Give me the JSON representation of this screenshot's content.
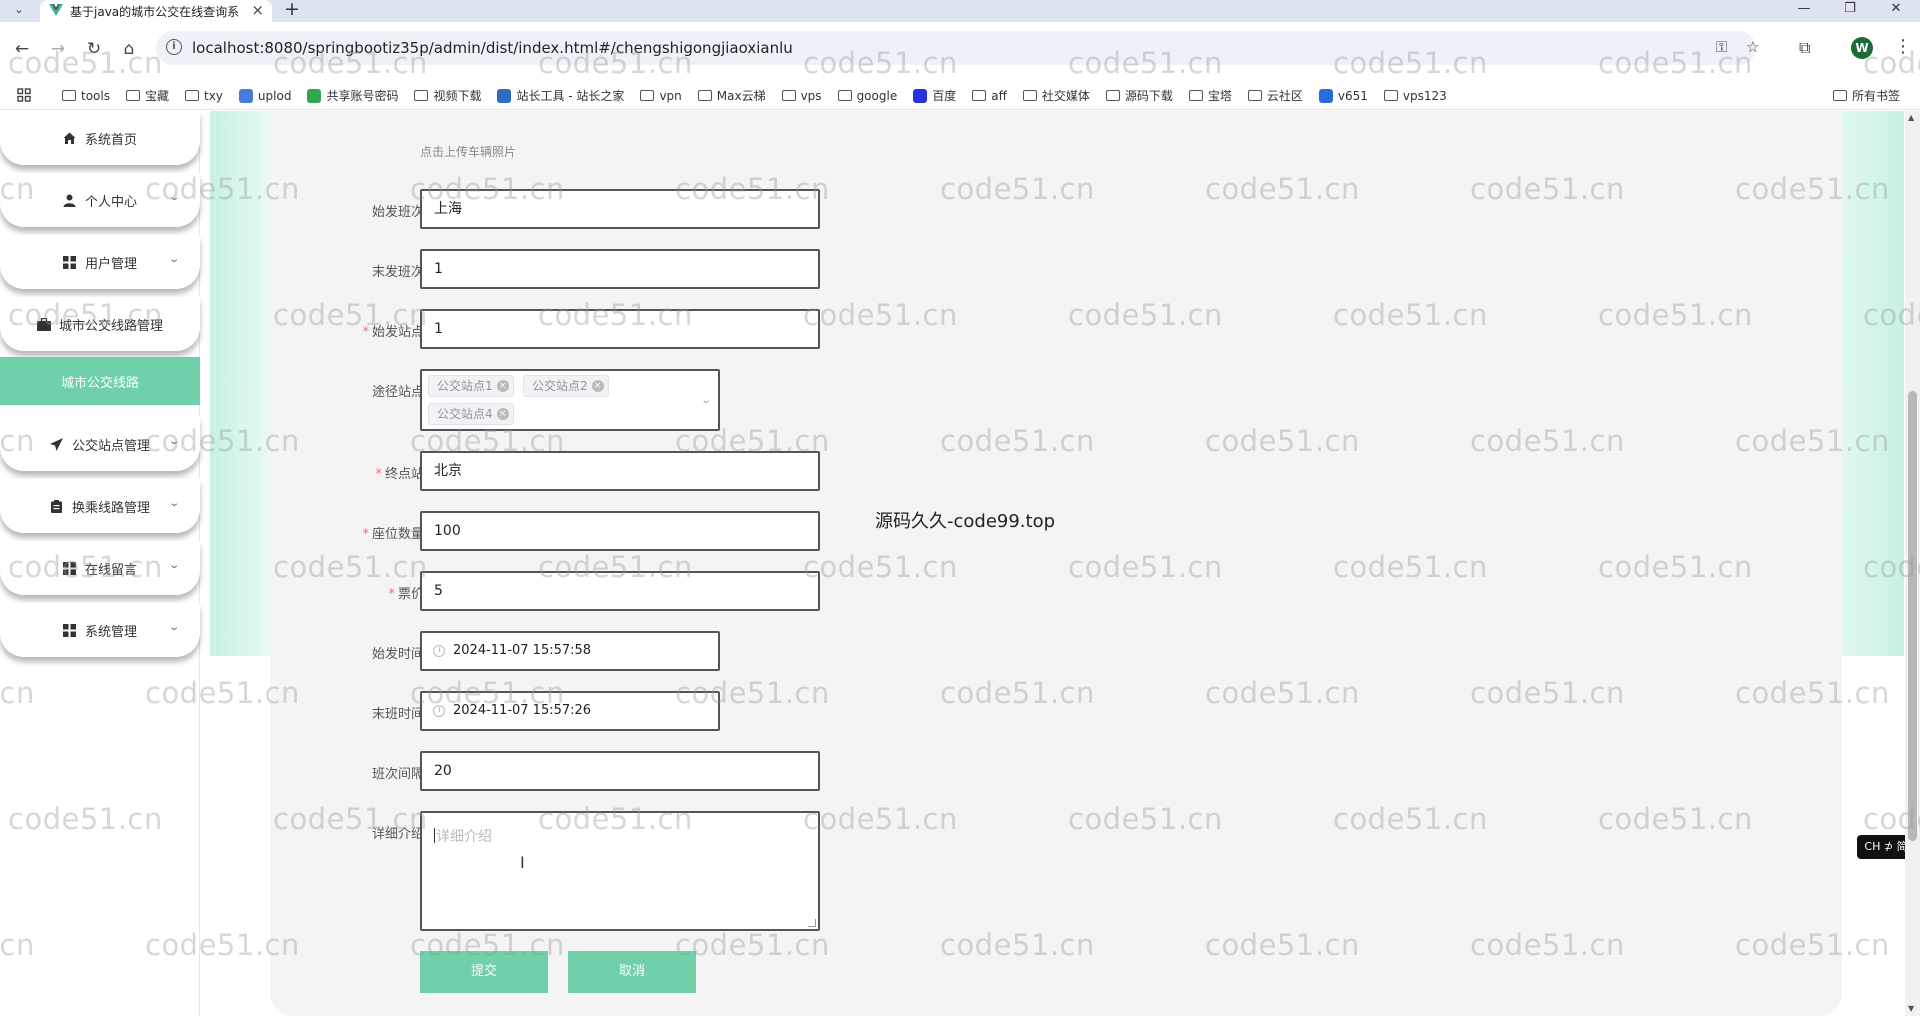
{
  "browser": {
    "tab_title": "基于java的城市公交在线查询系",
    "url": "localhost:8080/springbootiz35p/admin/dist/index.html#/chengshigongjiaoxianlu",
    "profile_initial": "W",
    "bookmarks": [
      "tools",
      "宝藏",
      "txy",
      "uplod",
      "共享账号密码",
      "视频下载",
      "站长工具 - 站长之家",
      "vpn",
      "Max云梯",
      "vps",
      "google",
      "百度",
      "aff",
      "社交媒体",
      "源码下载",
      "宝塔",
      "云社区",
      "v651",
      "vps123"
    ],
    "all_bookmarks": "所有书签"
  },
  "sidebar": {
    "items": [
      {
        "label": "系统首页",
        "icon": "home-icon"
      },
      {
        "label": "个人中心",
        "icon": "user-icon"
      },
      {
        "label": "用户管理",
        "icon": "grid-icon"
      },
      {
        "label": "城市公交线路管理",
        "icon": "briefcase-icon"
      },
      {
        "label": "公交站点管理",
        "icon": "paper-plane-icon"
      },
      {
        "label": "换乘线路管理",
        "icon": "clipboard-icon"
      },
      {
        "label": "在线留言",
        "icon": "grid-icon"
      },
      {
        "label": "系统管理",
        "icon": "grid-icon"
      }
    ],
    "active_sub": "城市公交线路"
  },
  "form": {
    "upload_hint": "点击上传车辆照片",
    "start_bus": {
      "label": "始发班次",
      "value": "上海"
    },
    "last_bus": {
      "label": "末发班次",
      "value": "1"
    },
    "start_station": {
      "label": "始发站点",
      "value": "1"
    },
    "via_stations": {
      "label": "途径站点",
      "tags": [
        "公交站点1",
        "公交站点2",
        "公交站点4"
      ]
    },
    "end_station": {
      "label": "终点站",
      "value": "北京"
    },
    "seats": {
      "label": "座位数量",
      "value": "100"
    },
    "fare": {
      "label": "票价",
      "value": "5"
    },
    "start_time": {
      "label": "始发时间",
      "value": "2024-11-07 15:57:58"
    },
    "end_time": {
      "label": "末班时间",
      "value": "2024-11-07 15:57:26"
    },
    "interval": {
      "label": "班次间隔",
      "value": "20"
    },
    "detail": {
      "label": "详细介绍",
      "placeholder": "详细介绍"
    },
    "submit": "提交",
    "cancel": "取消"
  },
  "overlay_text": "源码久久-code99.top",
  "watermark": "code51.cn",
  "ime": "CH ⊅ 简",
  "colors": {
    "accent": "#6fd0a9",
    "required": "#f56c6c"
  }
}
